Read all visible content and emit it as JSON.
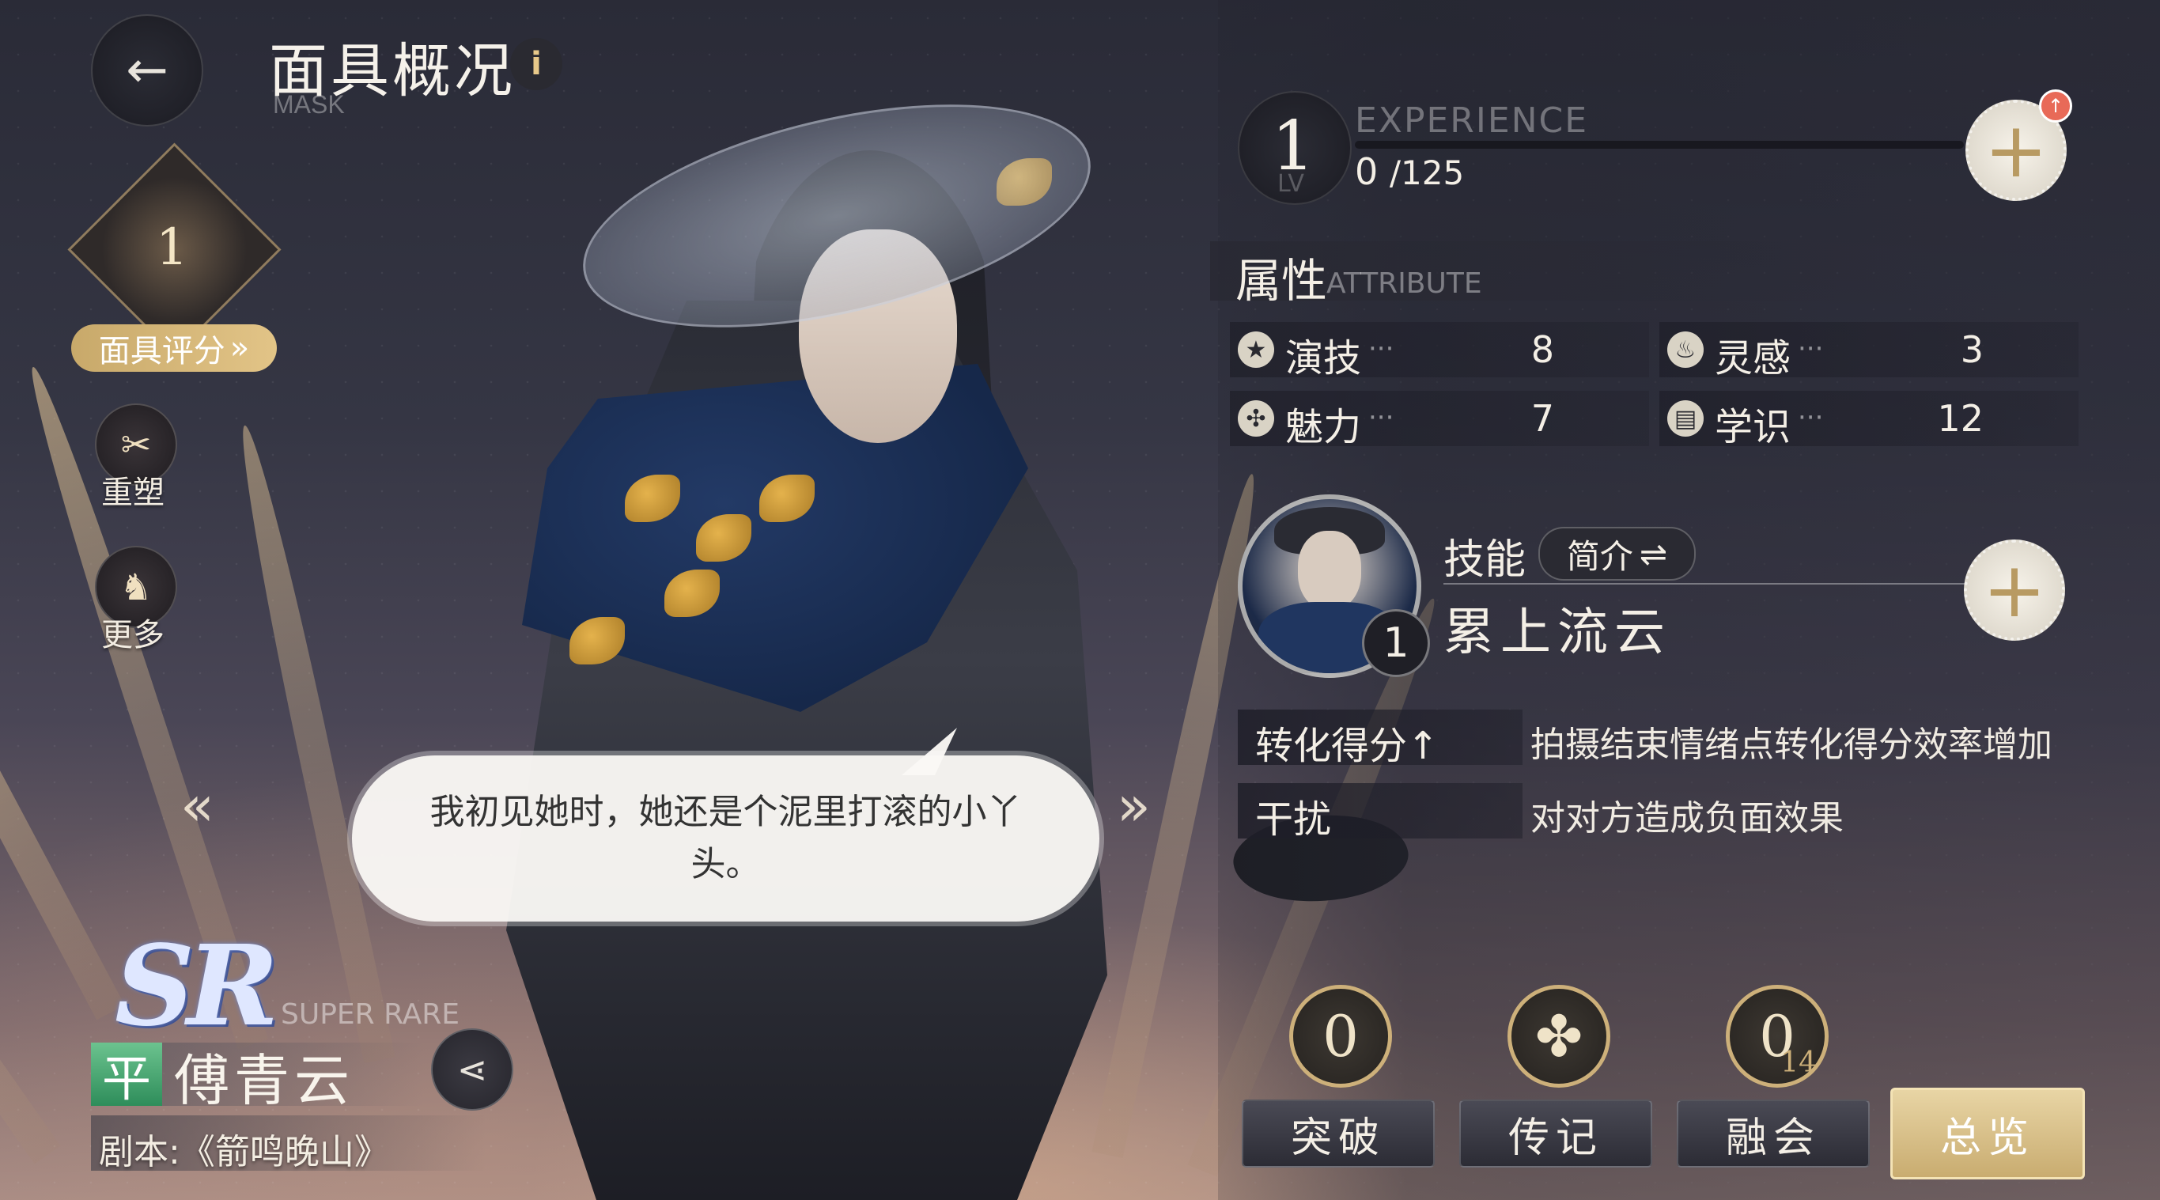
{
  "header": {
    "back_label": "←",
    "title": "面具概况",
    "subtitle": "MASK",
    "info_label": "i"
  },
  "left": {
    "rank_value": "1",
    "rate_button": "面具评分",
    "rate_chevron": "»",
    "reshape_label": "重塑",
    "more_label": "更多",
    "prev_arrow": "«",
    "next_arrow": "»"
  },
  "dialogue": {
    "text": "我初见她时，她还是个泥里打滚的小丫头。"
  },
  "nameplate": {
    "rarity_logo": "SR",
    "rarity_text": "SUPER RARE",
    "grade": "平",
    "name": "傅青云",
    "script": "剧本:《箭鸣晚山》"
  },
  "level": {
    "value": "1",
    "lv_text": "LV",
    "exp_label": "EXPERIENCE",
    "exp_current": "0",
    "exp_max": "/125",
    "exp_fraction": 0,
    "plus_label": "+",
    "badge": "↑"
  },
  "attributes": {
    "title": "属性",
    "subtitle": "ATTRIBUTE",
    "items": [
      {
        "name": "演技",
        "dots": "···",
        "value": "8",
        "icon": "star-icon"
      },
      {
        "name": "灵感",
        "dots": "···",
        "value": "3",
        "icon": "flame-icon"
      },
      {
        "name": "魅力",
        "dots": "···",
        "value": "7",
        "icon": "pinwheel-icon"
      },
      {
        "name": "学识",
        "dots": "···",
        "value": "12",
        "icon": "book-icon"
      }
    ]
  },
  "skill": {
    "label": "技能",
    "intro_button": "简介",
    "intro_icon": "⇌",
    "level": "1",
    "name": "累上流云",
    "plus_label": "+"
  },
  "effects": [
    {
      "key": "转化得分↑",
      "desc": "拍摄结束情绪点转化得分效率增加"
    },
    {
      "key": "干扰",
      "desc": "对对方造成负面效果"
    }
  ],
  "bottom": {
    "breakthrough_value": "0",
    "biography_icon": "flower-icon",
    "fusion_value": "0",
    "fusion_max": "14",
    "tabs": [
      "突破",
      "传记",
      "融会",
      "总览"
    ]
  },
  "colors": {
    "accent_gold": "#c9ac70",
    "grade_green": "#2e8d5a",
    "panel_dark": "#23242e"
  }
}
